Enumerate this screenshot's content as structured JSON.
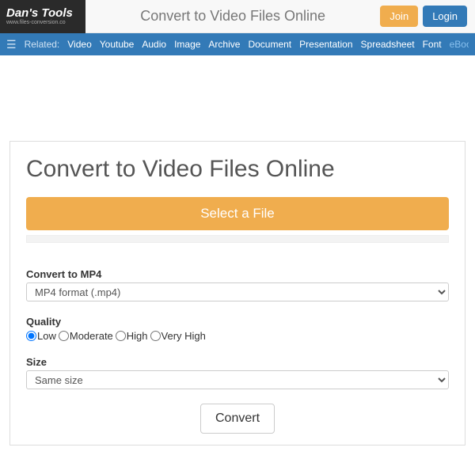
{
  "header": {
    "brand_title": "Dan's Tools",
    "brand_sub": "www.files-conversion.co",
    "page_title": "Convert to Video Files Online",
    "join_label": "Join",
    "login_label": "Login"
  },
  "nav": {
    "related_label": "Related:",
    "links": [
      "Video",
      "Youtube",
      "Audio",
      "Image",
      "Archive",
      "Document",
      "Presentation",
      "Spreadsheet",
      "Font",
      "eBook"
    ]
  },
  "main": {
    "heading": "Convert to Video Files Online",
    "select_file_label": "Select a File",
    "convert_to_label": "Convert to MP4",
    "format_selected": "MP4 format (.mp4)",
    "quality_label": "Quality",
    "quality_options": {
      "low": "Low",
      "moderate": "Moderate",
      "high": "High",
      "very_high": "Very High"
    },
    "quality_selected": "low",
    "size_label": "Size",
    "size_selected": "Same size",
    "convert_button": "Convert"
  }
}
